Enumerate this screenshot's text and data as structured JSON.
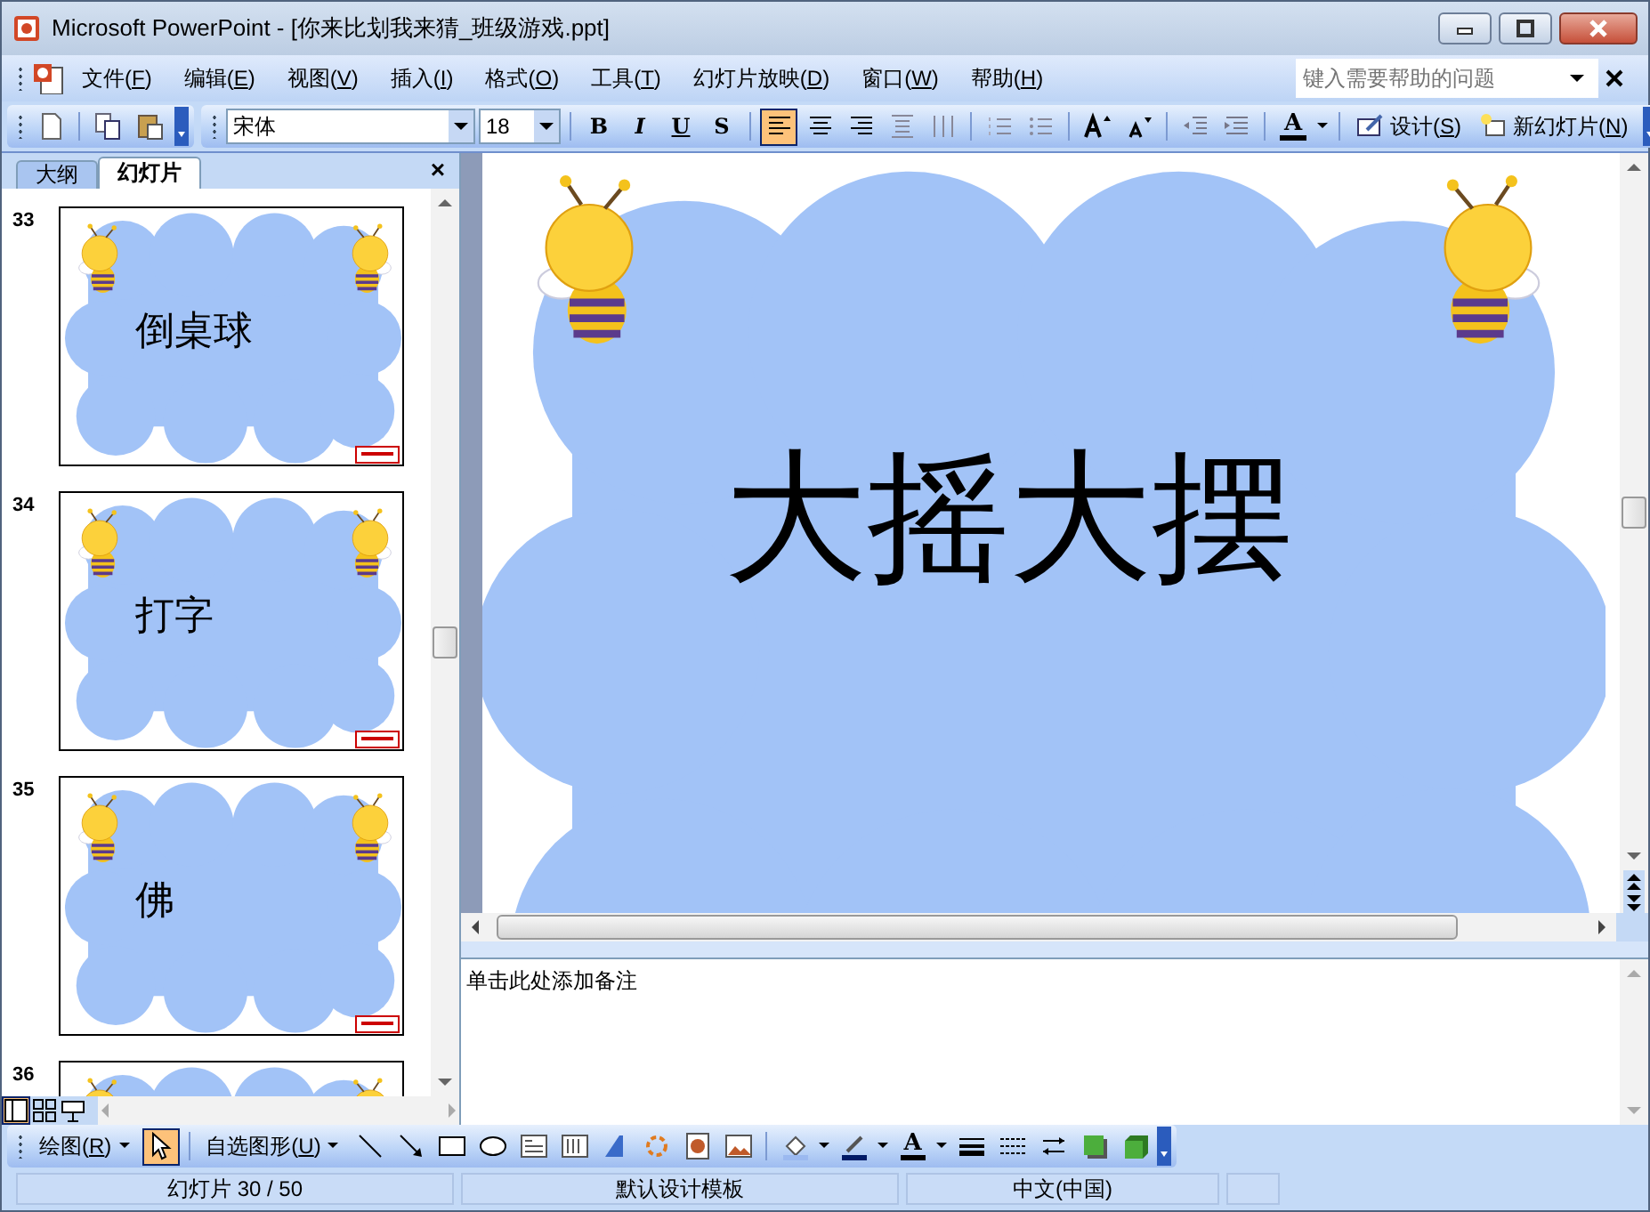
{
  "window": {
    "title": "Microsoft PowerPoint - [你来比划我来猜_班级游戏.ppt]"
  },
  "menu": [
    "文件(F)",
    "编辑(E)",
    "视图(V)",
    "插入(I)",
    "格式(O)",
    "工具(T)",
    "幻灯片放映(D)",
    "窗口(W)",
    "帮助(H)"
  ],
  "help_search": {
    "placeholder": "键入需要帮助的问题"
  },
  "formatting": {
    "font": "宋体",
    "size": "18",
    "style_buttons": [
      "B",
      "I",
      "U",
      "S"
    ],
    "alignment_buttons": [
      {
        "selected": true
      },
      {
        "selected": false
      },
      {
        "selected": false
      }
    ],
    "font_color": "A",
    "buttons": [
      "设计(S)",
      "新幻灯片(N)"
    ]
  },
  "pane_tabs": [
    {
      "label": "大纲",
      "selected": false
    },
    {
      "label": "幻灯片",
      "selected": true
    }
  ],
  "pane_close": "×",
  "thumbnails": [
    {
      "number": "33",
      "text": "倒桌球"
    },
    {
      "number": "34",
      "text": "打字"
    },
    {
      "number": "35",
      "text": "佛"
    },
    {
      "number": "36"
    }
  ],
  "view_buttons": [
    {
      "selected": true
    },
    {
      "selected": false
    },
    {
      "selected": false
    }
  ],
  "slide": {
    "text": "大摇大摆"
  },
  "notes": {
    "text": "单击此处添加备注"
  },
  "drawing": {
    "menu": "绘图(R)",
    "select_tool": {
      "selected": true
    },
    "autoshapes": "自选图形(U)",
    "font_color": "A"
  },
  "status_bar": [
    "幻灯片 30 / 50",
    "默认设计模板",
    "中文(中国)"
  ]
}
